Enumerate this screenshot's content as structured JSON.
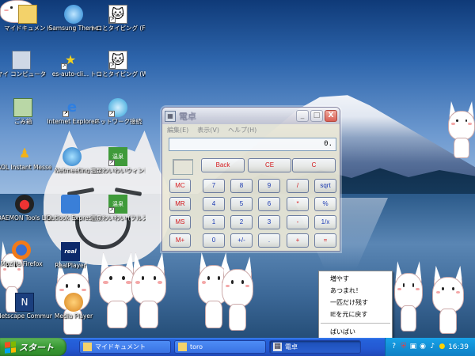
{
  "desktop": {
    "icons": [
      {
        "label": "マイドキュメント",
        "icon": "folder-icon"
      },
      {
        "label": "マイ コンピュータ",
        "icon": "computer-icon"
      },
      {
        "label": "ごみ箱",
        "icon": "recycle-bin-icon"
      },
      {
        "label": "AOL Instant Messenger",
        "icon": "aim-icon"
      },
      {
        "label": "DAEMON Tools Lite",
        "icon": "daemon-tools-icon"
      },
      {
        "label": "Mozilla Firefox",
        "icon": "firefox-icon"
      },
      {
        "label": "Netscape Communicator",
        "icon": "netscape-icon"
      },
      {
        "label": "Samsung Theme",
        "icon": "samsung-theme-icon"
      },
      {
        "label": "es-auto-cli...",
        "icon": "star-shortcut-icon"
      },
      {
        "label": "Internet Explorer",
        "icon": "internet-explorer-icon"
      },
      {
        "label": "Netmeeting",
        "icon": "netmeeting-icon"
      },
      {
        "label": "Outlook Express",
        "icon": "outlook-express-icon"
      },
      {
        "label": "RealPlayer",
        "icon": "realplayer-icon"
      },
      {
        "label": "Media Player",
        "icon": "media-player-icon"
      },
      {
        "label": "トロとタイピング (FullScreen...",
        "icon": "toro-typing-icon"
      },
      {
        "label": "トロとタイピング (WindowMo...",
        "icon": "toro-typing-window-icon"
      },
      {
        "label": "ネットワーク接続",
        "icon": "network-icon"
      },
      {
        "label": "温泉わいわいウィンドウモ...",
        "icon": "onsen-icon"
      },
      {
        "label": "温泉わいわい (フルスクリ...",
        "icon": "onsen-fullscreen-icon"
      }
    ]
  },
  "calculator": {
    "title": "電卓",
    "menu": [
      "編集(E)",
      "表示(V)",
      "ヘルプ(H)"
    ],
    "display_value": "0.",
    "controls": {
      "minimize": "_",
      "maximize": "□",
      "close": "X"
    },
    "top_row": [
      {
        "label": "Back",
        "color": "red"
      },
      {
        "label": "CE",
        "color": "red"
      },
      {
        "label": "C",
        "color": "red"
      }
    ],
    "rows": [
      [
        {
          "label": "MC",
          "color": "red"
        },
        {
          "label": "7",
          "color": "blue"
        },
        {
          "label": "8",
          "color": "blue"
        },
        {
          "label": "9",
          "color": "blue"
        },
        {
          "label": "/",
          "color": "red"
        },
        {
          "label": "sqrt",
          "color": "blue"
        }
      ],
      [
        {
          "label": "MR",
          "color": "red"
        },
        {
          "label": "4",
          "color": "blue"
        },
        {
          "label": "5",
          "color": "blue"
        },
        {
          "label": "6",
          "color": "blue"
        },
        {
          "label": "*",
          "color": "red"
        },
        {
          "label": "%",
          "color": "blue"
        }
      ],
      [
        {
          "label": "MS",
          "color": "red"
        },
        {
          "label": "1",
          "color": "blue"
        },
        {
          "label": "2",
          "color": "blue"
        },
        {
          "label": "3",
          "color": "blue"
        },
        {
          "label": "-",
          "color": "red"
        },
        {
          "label": "1/x",
          "color": "blue"
        }
      ],
      [
        {
          "label": "M+",
          "color": "red"
        },
        {
          "label": "0",
          "color": "blue"
        },
        {
          "label": "+/-",
          "color": "blue"
        },
        {
          "label": ".",
          "color": "blue"
        },
        {
          "label": "+",
          "color": "red"
        },
        {
          "label": "=",
          "color": "red"
        }
      ]
    ]
  },
  "context_menu": {
    "items": [
      "増やす",
      "あつまれ！",
      "一匹だけ残す",
      "IEを元に戻す"
    ],
    "last_item": "ばいばい"
  },
  "taskbar": {
    "start_label": "スタート",
    "tasks": [
      {
        "label": "マイドキュメント",
        "icon": "folder-icon",
        "active": false
      },
      {
        "label": "toro",
        "icon": "folder-icon",
        "active": false
      },
      {
        "label": "電卓",
        "icon": "calculator-icon",
        "active": true
      }
    ],
    "clock": "16:39"
  },
  "colors": {
    "calc_red_text": "#d11111",
    "calc_blue_text": "#1836b4",
    "taskbar_blue": "#2458d2",
    "start_green": "#3a9a34",
    "tray_blue": "#1391d6"
  }
}
